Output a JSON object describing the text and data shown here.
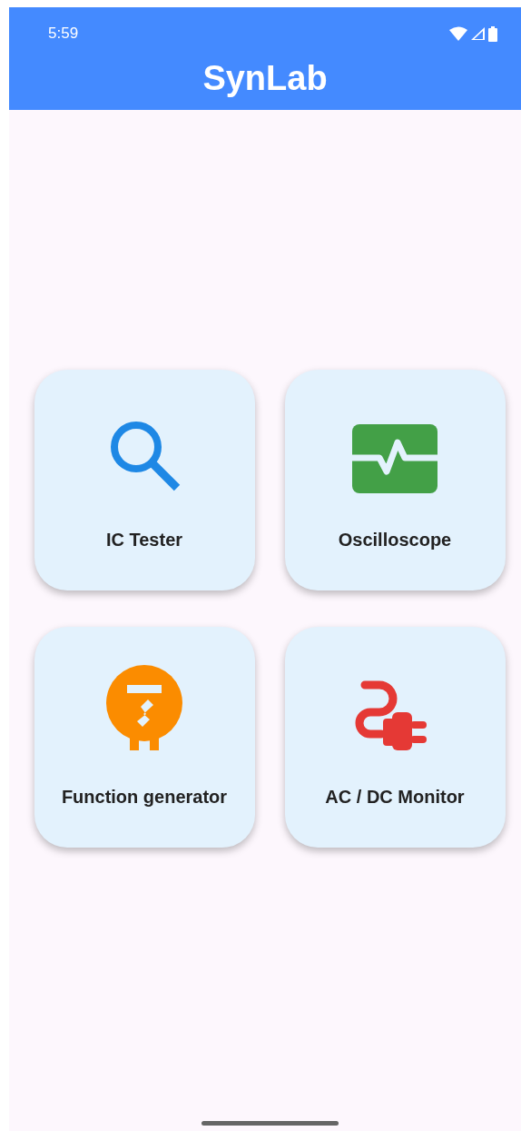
{
  "status_bar": {
    "time": "5:59"
  },
  "app_bar": {
    "title": "SynLab"
  },
  "tools": [
    {
      "label": "IC Tester",
      "kind": "search"
    },
    {
      "label": "Oscilloscope",
      "kind": "scope"
    },
    {
      "label": "Function generator",
      "kind": "generator"
    },
    {
      "label": "AC / DC Monitor",
      "kind": "plug"
    }
  ]
}
